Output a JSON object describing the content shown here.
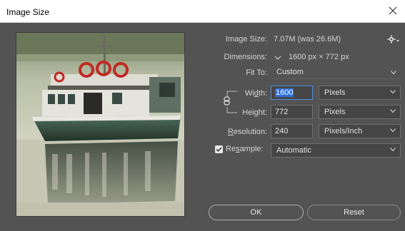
{
  "window": {
    "title": "Image Size",
    "close_icon": "close-icon"
  },
  "info": {
    "image_size_label": "Image Size:",
    "image_size_value": "7.07M (was 26.6M)",
    "dimensions_label": "Dimensions:",
    "dimensions_value": "1600 px  ×  772 px",
    "fit_to_label": "Fit To:",
    "fit_to_value": "Custom"
  },
  "fields": {
    "width_label_pre": "Wi",
    "width_label_ul": "d",
    "width_label_post": "th:",
    "width_value": "1600",
    "width_unit": "Pixels",
    "height_label_pre": "Hei",
    "height_label_ul": "g",
    "height_label_post": "ht:",
    "height_value": "772",
    "height_unit": "Pixels",
    "resolution_label_ul": "R",
    "resolution_label_post": "esolution:",
    "resolution_value": "240",
    "resolution_unit": "Pixels/Inch",
    "resample_label_pre": "Re",
    "resample_label_ul": "s",
    "resample_label_post": "ample:",
    "resample_checked": true,
    "resample_value": "Automatic"
  },
  "buttons": {
    "ok": "OK",
    "reset": "Reset"
  },
  "colors": {
    "panel": "#535353",
    "accent": "#2d6fd8",
    "titlebar": "#ffffff"
  }
}
